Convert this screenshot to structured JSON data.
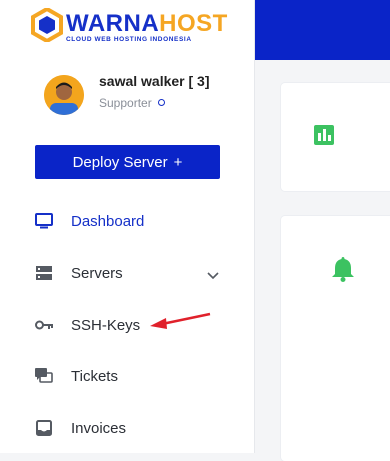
{
  "brand": {
    "name_part1": "WARNA",
    "name_part2": "HOST",
    "tagline": "CLOUD WEB HOSTING INDONESIA",
    "colors": {
      "primary": "#0a24c8",
      "accent": "#f5a623",
      "green": "#3cc261",
      "arrow": "#e0212b"
    }
  },
  "user": {
    "name": "sawal walker [ 3]",
    "role": "Supporter",
    "avatar_icon": "user-avatar"
  },
  "deploy_button": {
    "label": "Deploy Server",
    "icon": "plus-icon",
    "icon_glyph": "+"
  },
  "nav": {
    "items": [
      {
        "label": "Dashboard",
        "icon": "monitor-icon",
        "active": true
      },
      {
        "label": "Servers",
        "icon": "server-icon",
        "expandable": true
      },
      {
        "label": "SSH-Keys",
        "icon": "key-icon"
      },
      {
        "label": "Tickets",
        "icon": "chat-icon"
      },
      {
        "label": "Invoices",
        "icon": "inbox-icon"
      }
    ]
  },
  "cards": [
    {
      "icon": "bar-chart-icon"
    },
    {
      "icon": "bell-icon"
    }
  ],
  "annotation": {
    "type": "arrow",
    "target": "SSH-Keys"
  }
}
